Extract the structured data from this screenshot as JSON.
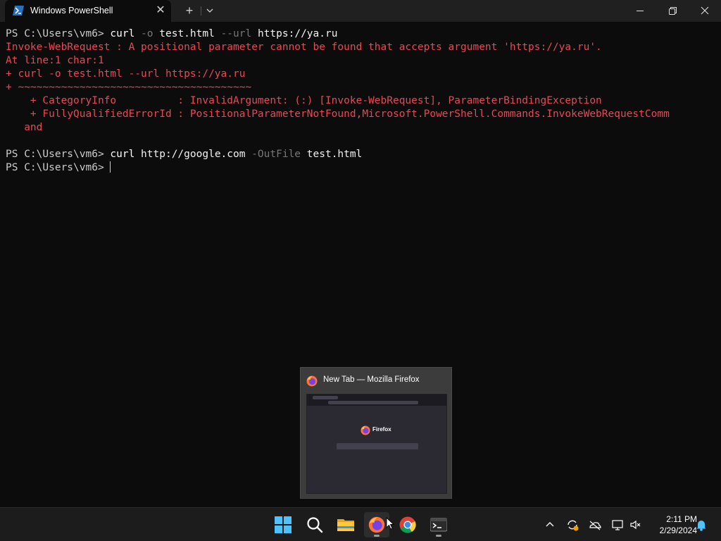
{
  "window": {
    "tab_title": "Windows PowerShell",
    "new_tab_symbol": "+",
    "close_symbol": "✕"
  },
  "terminal": {
    "lines": [
      {
        "type": "cmd",
        "prompt": "PS C:\\Users\\vm6> ",
        "command": "curl",
        "args": [
          {
            "text": " -o",
            "param": true
          },
          {
            "text": " test.html",
            "param": false
          },
          {
            "text": " --url",
            "param": true
          },
          {
            "text": " https://ya.ru",
            "param": false
          }
        ]
      },
      {
        "type": "err",
        "text": "Invoke-WebRequest : A positional parameter cannot be found that accepts argument 'https://ya.ru'."
      },
      {
        "type": "err",
        "text": "At line:1 char:1"
      },
      {
        "type": "err",
        "text": "+ curl -o test.html --url https://ya.ru"
      },
      {
        "type": "err",
        "text": "+ ~~~~~~~~~~~~~~~~~~~~~~~~~~~~~~~~~~~~~~"
      },
      {
        "type": "err",
        "text": "    + CategoryInfo          : InvalidArgument: (:) [Invoke-WebRequest], ParameterBindingException"
      },
      {
        "type": "err",
        "text": "    + FullyQualifiedErrorId : PositionalParameterNotFound,Microsoft.PowerShell.Commands.InvokeWebRequestComm"
      },
      {
        "type": "err",
        "text": "   and"
      },
      {
        "type": "blank",
        "text": ""
      },
      {
        "type": "cmd",
        "prompt": "PS C:\\Users\\vm6> ",
        "command": "curl",
        "args": [
          {
            "text": " http://google.com",
            "param": false
          },
          {
            "text": " -OutFile",
            "param": true
          },
          {
            "text": " test.html",
            "param": false
          }
        ]
      },
      {
        "type": "prompt",
        "prompt": "PS C:\\Users\\vm6> "
      }
    ]
  },
  "preview": {
    "title": "New Tab — Mozilla Firefox",
    "brand": "Firefox"
  },
  "taskbar": {
    "items": [
      "start-icon",
      "search-icon",
      "file-explorer-icon",
      "firefox-icon",
      "chrome-icon",
      "terminal-icon"
    ],
    "tray": [
      "chevron-up-icon",
      "sync-icon",
      "onedrive-icon",
      "network-icon",
      "speaker-muted-icon",
      "notification-bell-icon"
    ],
    "time": "2:11 PM",
    "date": "2/29/2024"
  },
  "colors": {
    "terminal_bg": "#0c0c0c",
    "error": "#e74856",
    "text": "#cccccc",
    "param": "#767676",
    "titlebar": "#202020",
    "taskbar": "#1c1c1c"
  }
}
